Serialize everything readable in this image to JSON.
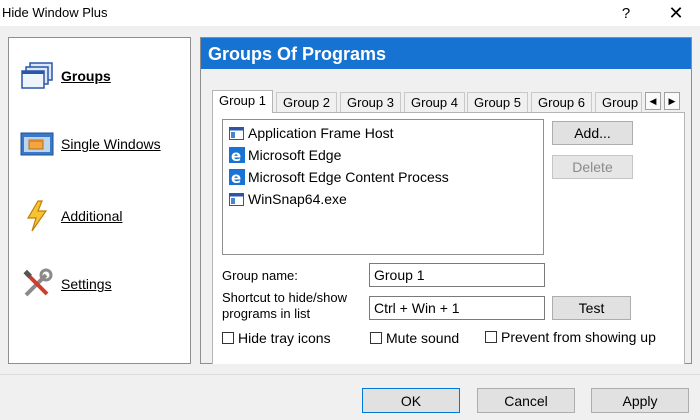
{
  "window": {
    "title": "Hide Window Plus",
    "help_glyph": "?",
    "close_glyph": "✕"
  },
  "sidebar": {
    "items": [
      {
        "label": "Groups",
        "icon": "groups-icon",
        "active": true
      },
      {
        "label": "Single Windows",
        "icon": "single-windows-icon",
        "active": false
      },
      {
        "label": "Additional",
        "icon": "lightning-icon",
        "active": false
      },
      {
        "label": "Settings",
        "icon": "tools-icon",
        "active": false
      }
    ]
  },
  "header": {
    "title": "Groups Of Programs"
  },
  "tabs": [
    "Group 1",
    "Group 2",
    "Group 3",
    "Group 4",
    "Group 5",
    "Group 6",
    "Group"
  ],
  "active_tab": 0,
  "tab_scroll": {
    "left": "◀",
    "right": "▶"
  },
  "programs": [
    {
      "name": "Application Frame Host",
      "icon": "window-icon"
    },
    {
      "name": "Microsoft Edge",
      "icon": "edge-icon"
    },
    {
      "name": "Microsoft Edge Content Process",
      "icon": "edge-icon"
    },
    {
      "name": "WinSnap64.exe",
      "icon": "window-icon"
    }
  ],
  "list_buttons": {
    "add": "Add...",
    "delete": "Delete"
  },
  "form": {
    "group_name_label": "Group name:",
    "group_name_value": "Group 1",
    "shortcut_label_1": "Shortcut to hide/show",
    "shortcut_label_2": "programs in list",
    "shortcut_value": "Ctrl + Win + 1",
    "test_label": "Test"
  },
  "options": {
    "hide_tray": "Hide tray icons",
    "mute": "Mute sound",
    "prevent": "Prevent from showing up"
  },
  "footer": {
    "ok": "OK",
    "cancel": "Cancel",
    "apply": "Apply"
  },
  "colors": {
    "header_bg": "#1673d1",
    "accent": "#0078d7"
  }
}
